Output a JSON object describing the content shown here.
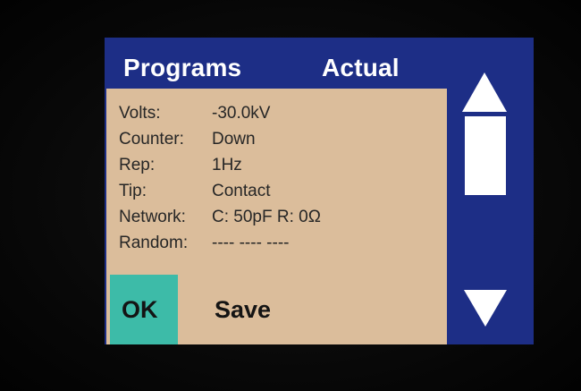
{
  "header": {
    "left_title": "Programs",
    "right_title": "Actual"
  },
  "settings": [
    {
      "label": "Volts:",
      "value": "-30.0kV"
    },
    {
      "label": "Counter:",
      "value": "Down"
    },
    {
      "label": "Rep:",
      "value": "1Hz"
    },
    {
      "label": "Tip:",
      "value": "Contact"
    },
    {
      "label": "Network:",
      "value": "C: 50pF R: 0Ω"
    },
    {
      "label": "Random:",
      "value": "---- ---- ----"
    }
  ],
  "actions": {
    "ok_label": "OK",
    "save_label": "Save"
  },
  "scroll": {
    "up_icon": "arrow-up-icon",
    "down_icon": "arrow-down-icon"
  },
  "colors": {
    "background": "#050505",
    "header_blue": "#1d2e86",
    "panel_tan": "#dbbd9b",
    "ok_teal": "#3dbba8",
    "text": "#262626",
    "white": "#ffffff"
  }
}
